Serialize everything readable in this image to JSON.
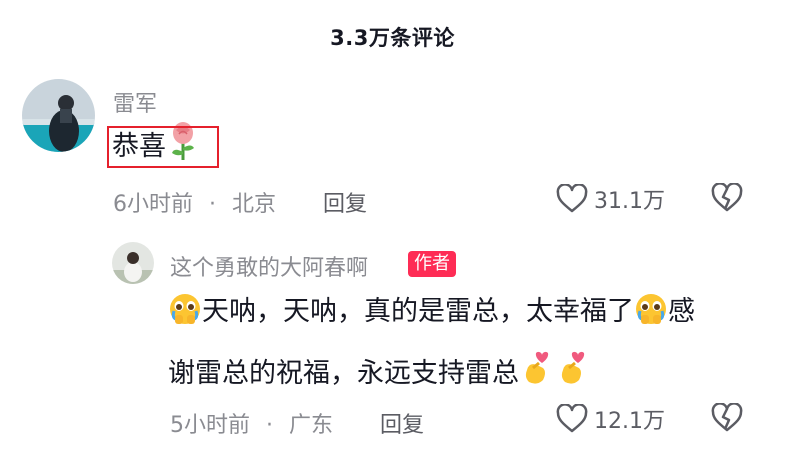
{
  "header": {
    "title": "3.3万条评论"
  },
  "comments": [
    {
      "username": "雷军",
      "text": "恭喜",
      "emoji": "rose",
      "time": "6小时前",
      "separator": "·",
      "location": "北京",
      "reply_label": "回复",
      "likes": "31.1万"
    }
  ],
  "reply": {
    "username": "这个勇敢的大阿春啊",
    "author_tag": "作者",
    "line1_part1": "天呐，天呐，真的是雷总，太幸福了",
    "line1_part2": "感",
    "line2": "谢雷总的祝福，永远支持雷总",
    "emojis": [
      "crying-face",
      "crying-face",
      "finger-heart",
      "finger-heart"
    ],
    "time": "5小时前",
    "separator": "·",
    "location": "广东",
    "reply_label": "回复",
    "likes": "12.1万"
  },
  "colors": {
    "accent": "#fe2c55",
    "highlight_border": "#e5202c",
    "muted_text": "#8a8b91"
  }
}
